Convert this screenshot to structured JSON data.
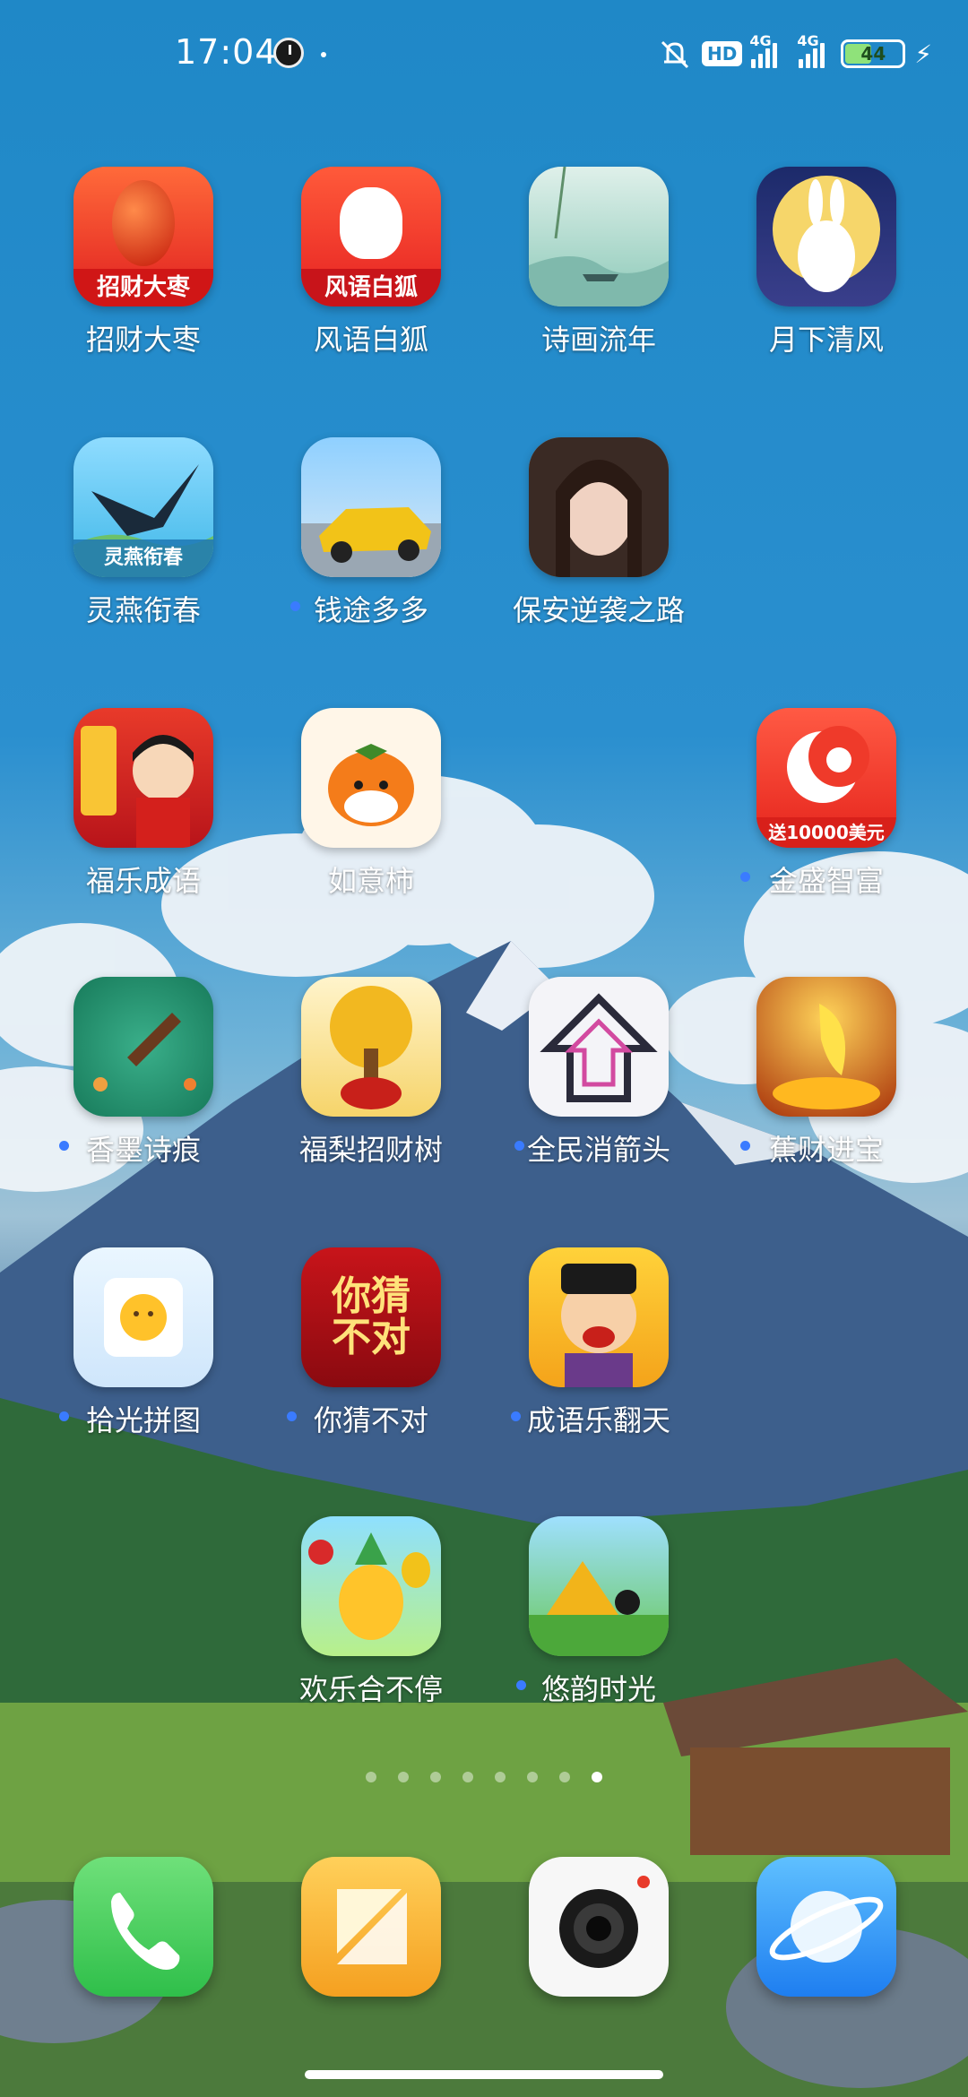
{
  "status_bar": {
    "time": "17:04",
    "hd_badge": "HD",
    "network_1": "4G",
    "network_2": "4G",
    "battery": "44"
  },
  "apps": [
    {
      "label": "招财大枣",
      "ribbon": "招财大枣",
      "icon": "red-date-icon",
      "new": false
    },
    {
      "label": "风语白狐",
      "ribbon": "风语白狐",
      "icon": "white-fox-icon",
      "new": false
    },
    {
      "label": "诗画流年",
      "icon": "landscape-boat-icon",
      "new": false
    },
    {
      "label": "月下清风",
      "icon": "moon-rabbit-icon",
      "new": false
    },
    {
      "label": "灵燕衔春",
      "ribbon": "灵燕衔春",
      "icon": "swallow-icon",
      "new": false
    },
    {
      "label": "钱途多多",
      "icon": "race-car-icon",
      "new": true
    },
    {
      "label": "保安逆袭之路",
      "icon": "woman-portrait-icon",
      "new": false
    },
    {
      "label": "福乐成语",
      "icon": "idiom-boy-icon",
      "new": false
    },
    {
      "label": "如意柿",
      "icon": "persimmon-icon",
      "new": false
    },
    {
      "label": "金盛智富",
      "ribbon": "送10000美元",
      "icon": "crescent-logo-icon",
      "new": true
    },
    {
      "label": "香墨诗痕",
      "icon": "boat-pond-icon",
      "new": true
    },
    {
      "label": "福梨招财树",
      "icon": "money-tree-icon",
      "new": false
    },
    {
      "label": "全民消箭头",
      "icon": "arrow-puzzle-icon",
      "new": true
    },
    {
      "label": "蕉财进宝",
      "icon": "banana-coins-icon",
      "new": true
    },
    {
      "label": "拾光拼图",
      "icon": "puzzle-sun-icon",
      "new": true
    },
    {
      "label": "你猜不对",
      "icon": "guess-text-icon",
      "icon_text": "你猜不对",
      "new": true
    },
    {
      "label": "成语乐翻天",
      "icon": "scholar-icon",
      "new": true
    },
    {
      "label": "欢乐合不停",
      "icon": "pineapple-icon",
      "new": false
    },
    {
      "label": "悠韵时光",
      "icon": "camping-icon",
      "new": true
    }
  ],
  "dock": [
    {
      "name": "phone",
      "icon": "phone-icon"
    },
    {
      "name": "notes",
      "icon": "notes-icon"
    },
    {
      "name": "camera",
      "icon": "camera-icon"
    },
    {
      "name": "browser",
      "icon": "planet-browser-icon"
    }
  ],
  "page_indicator": {
    "pages": 8,
    "active": 8
  },
  "colors": {
    "sky": "#1f88c7",
    "notification_dot": "#3a7bff"
  }
}
